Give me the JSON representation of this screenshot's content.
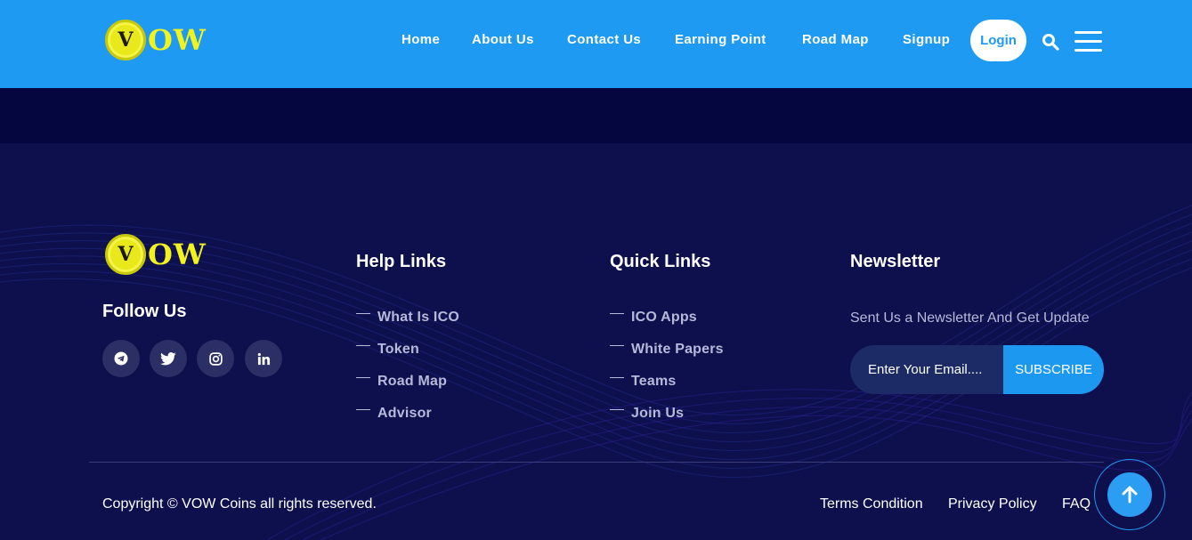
{
  "brand": {
    "coin_letter": "V",
    "wordmark": "OW"
  },
  "nav": {
    "items": [
      {
        "label": "Home"
      },
      {
        "label": "About Us"
      },
      {
        "label": "Contact Us"
      },
      {
        "label": "Earning Point"
      },
      {
        "label": "Road Map"
      },
      {
        "label": "Signup"
      }
    ],
    "login_label": "Login"
  },
  "footer": {
    "follow_title": "Follow Us",
    "social": [
      "telegram-icon",
      "twitter-icon",
      "instagram-icon",
      "linkedin-icon"
    ],
    "help": {
      "title": "Help Links",
      "links": [
        "What Is ICO",
        "Token",
        "Road Map",
        "Advisor"
      ]
    },
    "quick": {
      "title": "Quick Links",
      "links": [
        "ICO Apps",
        "White Papers",
        "Teams",
        "Join Us"
      ]
    },
    "newsletter": {
      "title": "Newsletter",
      "text": "Sent Us a Newsletter And Get Update",
      "placeholder": "Enter Your Email....",
      "button": "SUBSCRIBE"
    },
    "copyright": "Copyright © VOW Coins all rights reserved.",
    "bottom_links": [
      "Terms Condition",
      "Privacy Policy",
      "FAQ"
    ]
  },
  "colors": {
    "header_bg": "#1e9af2",
    "footer_bg": "#0e104d",
    "accent": "#1d98f0",
    "logo_yellow": "#f2f21c"
  }
}
